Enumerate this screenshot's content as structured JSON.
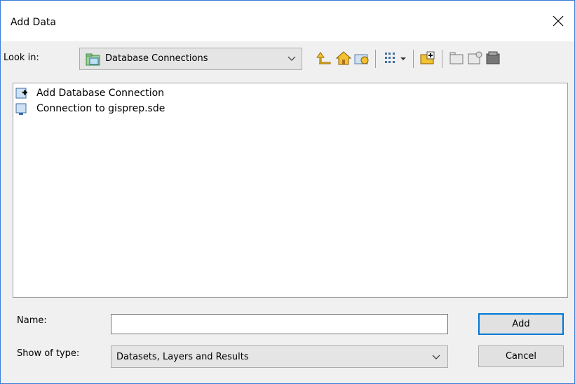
{
  "window": {
    "title": "Add Data"
  },
  "toolbar": {
    "lookin_label": "Look in:",
    "lookin_value": "Database Connections",
    "icons": [
      "up-one-level-icon",
      "home-icon",
      "connect-folder-icon",
      "view-list-icon",
      "view-dropdown-icon",
      "new-database-connection-icon",
      "new-folder-icon",
      "new-file-geodatabase-icon",
      "new-personal-geodatabase-icon"
    ]
  },
  "list": {
    "items": [
      {
        "label": "Add Database Connection",
        "icon": "add-database-connection-icon"
      },
      {
        "label": "Connection to gisprep.sde",
        "icon": "database-connection-icon"
      }
    ]
  },
  "form": {
    "name_label": "Name:",
    "name_value": "",
    "type_label": "Show of type:",
    "type_value": "Datasets, Layers and Results"
  },
  "buttons": {
    "add": "Add",
    "cancel": "Cancel"
  },
  "colors": {
    "accent": "#0078d7",
    "window_border": "#3b7bd6"
  }
}
